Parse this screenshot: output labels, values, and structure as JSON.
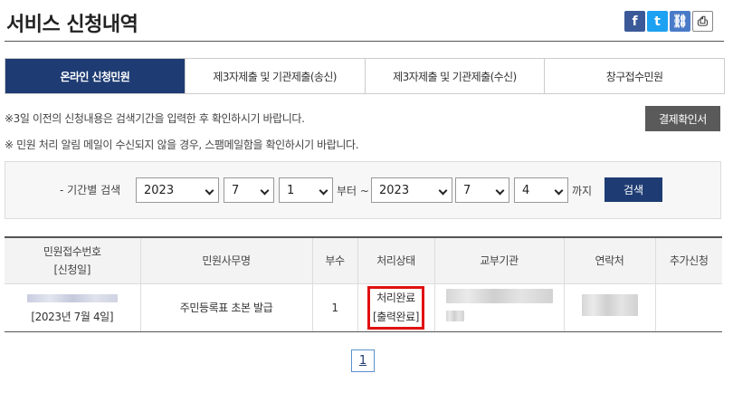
{
  "header": {
    "title": "서비스 신청내역"
  },
  "share": {
    "facebook_glyph": "f",
    "twitter_glyph": "t",
    "link_glyph": "⛓",
    "print_glyph": "⎙"
  },
  "tabs": [
    {
      "label": "온라인 신청민원",
      "active": true
    },
    {
      "label": "제3자제출 및 기관제출(송신)",
      "active": false
    },
    {
      "label": "제3자제출 및 기관제출(수신)",
      "active": false
    },
    {
      "label": "창구접수민원",
      "active": false
    }
  ],
  "notices": [
    "※3일 이전의 신청내용은 검색기간을 입력한 후 확인하시기 바랍니다.",
    "※ 민원 처리 알림 메일이 수신되지 않을 경우, 스팸메일함을 확인하시기 바랍니다."
  ],
  "confirm_button": "결제확인서",
  "search": {
    "label": "- 기간별 검색",
    "from_year": "2023",
    "from_month": "7",
    "from_day": "1",
    "from_text": "부터 ~",
    "to_year": "2023",
    "to_month": "7",
    "to_day": "4",
    "to_text": "까지",
    "button": "검색"
  },
  "table": {
    "headers": {
      "receipt_no": "민원접수번호",
      "receipt_date": "[신청일]",
      "name": "민원사무명",
      "copies": "부수",
      "status": "처리상태",
      "agency": "교부기관",
      "contact": "연락처",
      "extra": "추가신청"
    },
    "rows": [
      {
        "date": "[2023년 7월 4일]",
        "name": "주민등록표 초본 발급",
        "copies": "1",
        "status_line1": "처리완료",
        "status_line2": "[출력완료]"
      }
    ]
  },
  "pagination": {
    "current": "1"
  }
}
